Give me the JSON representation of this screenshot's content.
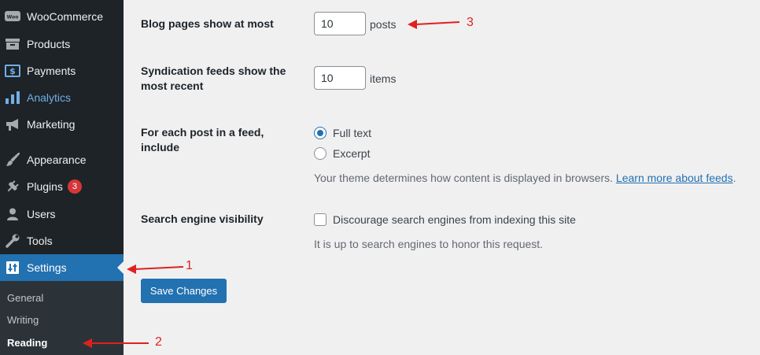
{
  "sidebar": {
    "items": [
      {
        "label": "WooCommerce",
        "icon": "woo-icon"
      },
      {
        "label": "Products",
        "icon": "archive-icon"
      },
      {
        "label": "Payments",
        "icon": "dollar-icon"
      },
      {
        "label": "Analytics",
        "icon": "bar-chart-icon"
      },
      {
        "label": "Marketing",
        "icon": "megaphone-icon"
      },
      {
        "label": "Appearance",
        "icon": "paintbrush-icon"
      },
      {
        "label": "Plugins",
        "icon": "plug-icon",
        "badge": "3"
      },
      {
        "label": "Users",
        "icon": "user-icon"
      },
      {
        "label": "Tools",
        "icon": "wrench-icon"
      },
      {
        "label": "Settings",
        "icon": "settings-sliders-icon"
      }
    ],
    "submenu": [
      "General",
      "Writing",
      "Reading"
    ]
  },
  "settings": {
    "blog_pages": {
      "label": "Blog pages show at most",
      "value": "10",
      "unit": "posts"
    },
    "syndication": {
      "label_line1": "Syndication feeds show the",
      "label_line2": "most recent",
      "value": "10",
      "unit": "items"
    },
    "feed_include": {
      "label_line1": "For each post in a feed,",
      "label_line2": "include",
      "options": [
        "Full text",
        "Excerpt"
      ],
      "selected": "Full text",
      "desc": "Your theme determines how content is displayed in browsers.",
      "link": "Learn more about feeds",
      "period": "."
    },
    "search_visibility": {
      "label": "Search engine visibility",
      "checkbox_label": "Discourage search engines from indexing this site",
      "desc": "It is up to search engines to honor this request."
    },
    "save_label": "Save Changes"
  },
  "annotations": {
    "one": "1",
    "two": "2",
    "three": "3"
  },
  "colors": {
    "accent": "#2271b1",
    "sidebar": "#1d2327",
    "annotation": "#e02020",
    "badge": "#d63638"
  }
}
